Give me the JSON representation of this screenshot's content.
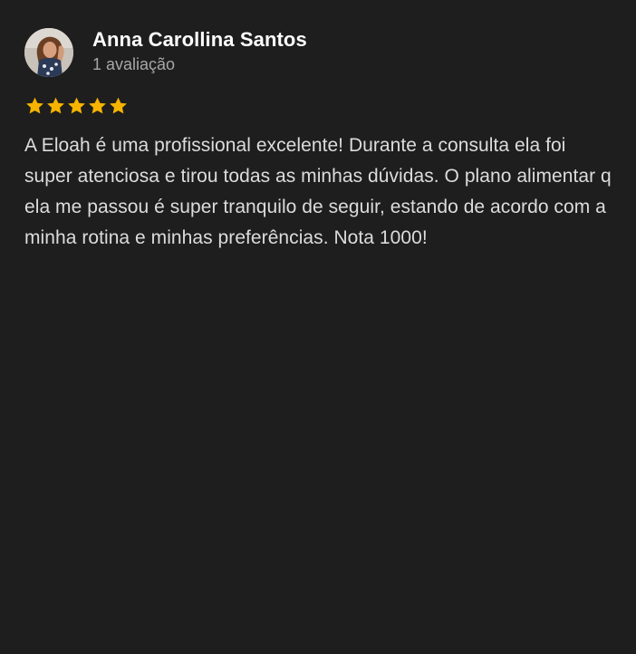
{
  "review": {
    "author_name": "Anna Carollina Santos",
    "author_meta": "1 avaliação",
    "avatar_icon": "user-avatar-photo",
    "rating": 5,
    "rating_max": 5,
    "star_color": "#f6b400",
    "text": "A Eloah é uma profissional excelente! Durante a consulta ela foi super atenciosa e tirou todas as minhas dúvidas. O plano alimentar q ela me passou é super tranquilo de seguir, estando de acordo com a minha rotina e minhas preferências. Nota 1000!"
  },
  "theme": {
    "background": "#1e1e1e",
    "name_color": "#ffffff",
    "meta_color": "#a7a7a7",
    "text_color": "#dcdcdc"
  }
}
